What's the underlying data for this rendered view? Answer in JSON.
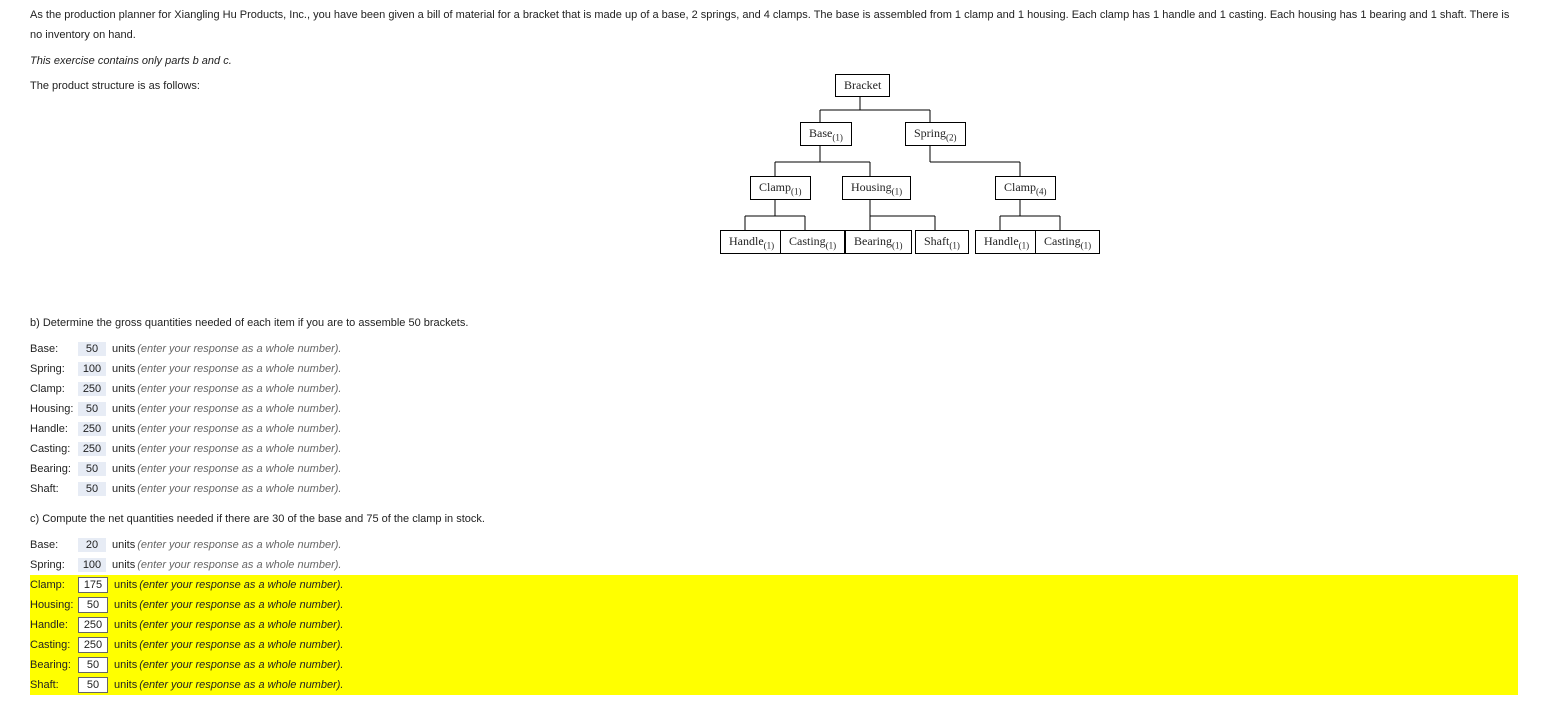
{
  "intro": {
    "p1": "As the production planner for Xiangling Hu Products, Inc., you have been given a bill of material for a bracket that is made up of a base, 2 springs, and 4 clamps. The base is assembled from 1 clamp and 1 housing. Each clamp has 1 handle and 1 casting. Each housing has 1 bearing and 1 shaft. There is no inventory on hand.",
    "p2": "This exercise contains only parts b and c.",
    "p3": "The product structure is as follows:"
  },
  "tree": {
    "n0": "Bracket",
    "n1": "Base",
    "n1s": "(1)",
    "n2": "Spring",
    "n2s": "(2)",
    "n3": "Clamp",
    "n3s": "(1)",
    "n4": "Housing",
    "n4s": "(1)",
    "n5": "Clamp",
    "n5s": "(4)",
    "n6": "Handle",
    "n6s": "(1)",
    "n7": "Casting",
    "n7s": "(1)",
    "n8": "Bearing",
    "n8s": "(1)",
    "n9": "Shaft",
    "n9s": "(1)",
    "n10": "Handle",
    "n10s": "(1)",
    "n11": "Casting",
    "n11s": "(1)"
  },
  "qb": {
    "text": "b) Determine the gross quantities needed of each item if you are to assemble 50 brackets.",
    "rows": [
      {
        "label": "Base:",
        "val": "50"
      },
      {
        "label": "Spring:",
        "val": "100"
      },
      {
        "label": "Clamp:",
        "val": "250"
      },
      {
        "label": "Housing:",
        "val": "50"
      },
      {
        "label": "Handle:",
        "val": "250"
      },
      {
        "label": "Casting:",
        "val": "250"
      },
      {
        "label": "Bearing:",
        "val": "50"
      },
      {
        "label": "Shaft:",
        "val": "50"
      }
    ]
  },
  "qc": {
    "text": "c) Compute the net quantities needed if there are 30 of the base and 75 of the clamp in stock.",
    "rows": [
      {
        "label": "Base:",
        "val": "20",
        "hl": false,
        "box": false
      },
      {
        "label": "Spring:",
        "val": "100",
        "hl": false,
        "box": false
      },
      {
        "label": "Clamp:",
        "val": "175",
        "hl": true,
        "box": true
      },
      {
        "label": "Housing:",
        "val": "50",
        "hl": true,
        "box": true
      },
      {
        "label": "Handle:",
        "val": "250",
        "hl": true,
        "box": true
      },
      {
        "label": "Casting:",
        "val": "250",
        "hl": true,
        "box": true
      },
      {
        "label": "Bearing:",
        "val": "50",
        "hl": true,
        "box": true
      },
      {
        "label": "Shaft:",
        "val": "50",
        "hl": true,
        "box": true
      }
    ]
  },
  "common": {
    "units": "units",
    "hint": "(enter your response as a whole number)."
  }
}
